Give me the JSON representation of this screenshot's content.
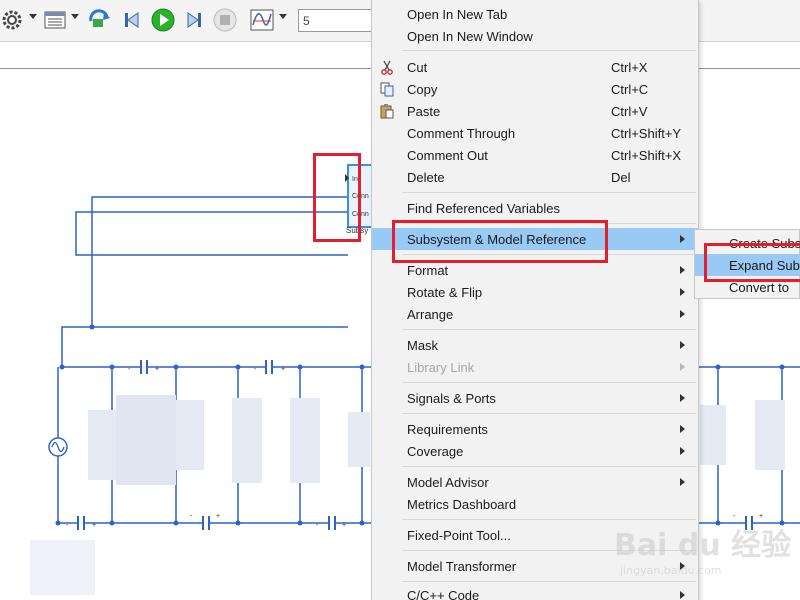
{
  "toolbar": {
    "sim_time_value": "5",
    "icons": [
      "settings-gear-icon",
      "model-explorer-icon",
      "update-diagram-icon",
      "step-back-icon",
      "run-play-icon",
      "step-forward-icon",
      "stop-icon",
      "data-inspector-icon"
    ]
  },
  "diagram": {
    "subsystem_label": "Subsy",
    "subsystem_ports": [
      "In",
      "Conn",
      "Conn"
    ],
    "capacitor_signs": {
      "minus": "-",
      "plus": "+"
    }
  },
  "context_menu": {
    "items": [
      {
        "label": "Open In New Tab",
        "shortcut": ""
      },
      {
        "label": "Open In New Window",
        "shortcut": ""
      },
      {
        "label": "Cut",
        "shortcut": "Ctrl+X",
        "icon": "scissors-icon"
      },
      {
        "label": "Copy",
        "shortcut": "Ctrl+C",
        "icon": "copy-icon"
      },
      {
        "label": "Paste",
        "shortcut": "Ctrl+V",
        "icon": "paste-icon"
      },
      {
        "label": "Comment Through",
        "shortcut": "Ctrl+Shift+Y"
      },
      {
        "label": "Comment Out",
        "shortcut": "Ctrl+Shift+X"
      },
      {
        "label": "Delete",
        "shortcut": "Del"
      },
      {
        "label": "Find Referenced Variables",
        "shortcut": ""
      },
      {
        "label": "Subsystem & Model Reference",
        "submenu": true,
        "highlighted": true
      },
      {
        "label": "Format",
        "submenu": true
      },
      {
        "label": "Rotate & Flip",
        "submenu": true
      },
      {
        "label": "Arrange",
        "submenu": true
      },
      {
        "label": "Mask",
        "submenu": true
      },
      {
        "label": "Library Link",
        "submenu": true,
        "disabled": true
      },
      {
        "label": "Signals & Ports",
        "submenu": true
      },
      {
        "label": "Requirements",
        "submenu": true
      },
      {
        "label": "Coverage",
        "submenu": true
      },
      {
        "label": "Model Advisor",
        "submenu": true
      },
      {
        "label": "Metrics Dashboard",
        "shortcut": ""
      },
      {
        "label": "Fixed-Point Tool...",
        "shortcut": ""
      },
      {
        "label": "Model Transformer",
        "submenu": true
      },
      {
        "label": "C/C++ Code",
        "submenu": true
      }
    ]
  },
  "submenu": {
    "items": [
      {
        "label": "Create Subsy"
      },
      {
        "label": "Expand Subs",
        "highlighted": true
      },
      {
        "label": "Convert to"
      }
    ]
  },
  "watermark": {
    "brand": "Bai du 经验",
    "url": "jingyan.baidu.com"
  },
  "colors": {
    "wire": "#2e62c9",
    "menu_bg": "#f2f2f2",
    "highlight": "#99c9f5",
    "annotation_red": "#e0202e",
    "run_green": "#2bb22b"
  }
}
